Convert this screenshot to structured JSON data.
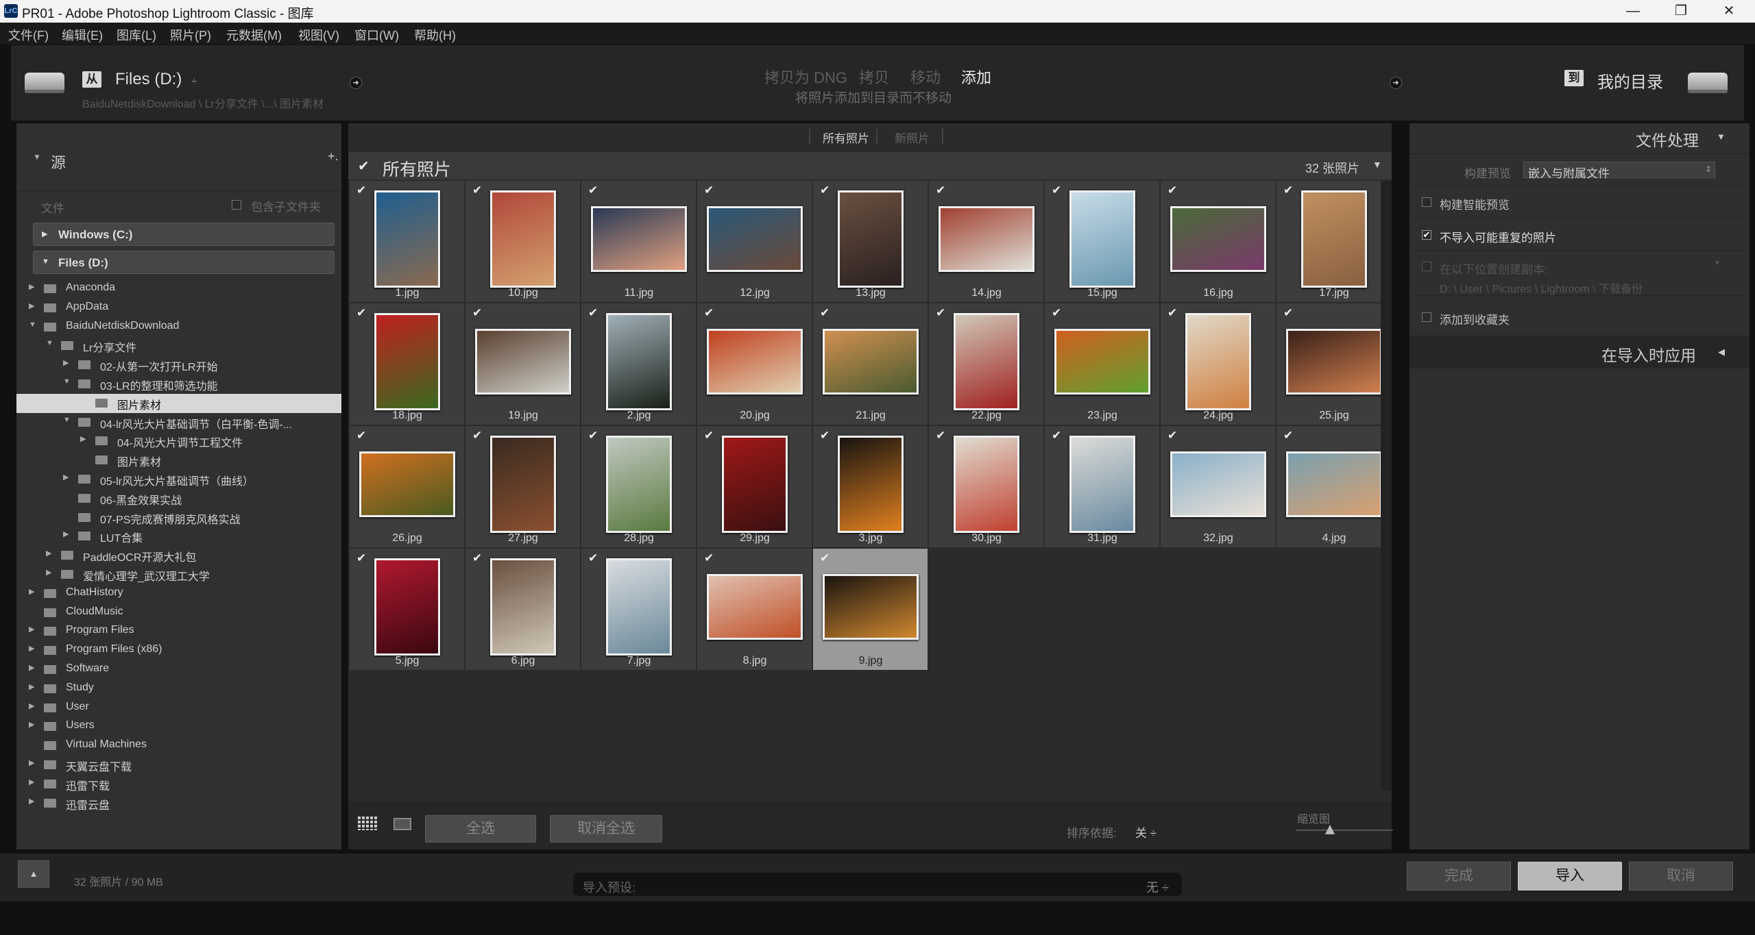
{
  "window": {
    "app_icon": "LrC",
    "title": "PR01 - Adobe Photoshop Lightroom Classic - 图库"
  },
  "menu": [
    "文件(F)",
    "编辑(E)",
    "图库(L)",
    "照片(P)",
    "元数据(M)",
    "视图(V)",
    "窗口(W)",
    "帮助(H)"
  ],
  "source_header": {
    "from_tag": "从",
    "drive": "Files (D:)",
    "path": "BaiduNetdiskDownload \\ Lr分享文件 \\...\\ 图片素材"
  },
  "mode_tabs": [
    "拷贝为 DNG",
    "拷贝",
    "移动",
    "添加"
  ],
  "active_mode": "添加",
  "mode_desc": "将照片添加到目录而不移动",
  "dest_header": {
    "to_tag": "到",
    "catalog": "我的目录"
  },
  "left_panel": {
    "title": "源",
    "add": "+.",
    "files_label": "文件",
    "include_subfolders": "包含子文件夹",
    "volumes": [
      "Windows (C:)",
      "Files (D:)"
    ],
    "tree": [
      {
        "label": "Anaconda",
        "level": 0,
        "arrow": "▶"
      },
      {
        "label": "AppData",
        "level": 0,
        "arrow": "▶"
      },
      {
        "label": "BaiduNetdiskDownload",
        "level": 0,
        "arrow": "▼"
      },
      {
        "label": "Lr分享文件",
        "level": 1,
        "arrow": "▼"
      },
      {
        "label": "02-从第一次打开LR开始",
        "level": 2,
        "arrow": "▶"
      },
      {
        "label": "03-LR的整理和筛选功能",
        "level": 2,
        "arrow": "▼"
      },
      {
        "label": "图片素材",
        "level": 3,
        "arrow": "",
        "selected": true
      },
      {
        "label": "04-lr风光大片基础调节（白平衡-色调-...",
        "level": 2,
        "arrow": "▼"
      },
      {
        "label": "04-风光大片调节工程文件",
        "level": 3,
        "arrow": "▶"
      },
      {
        "label": "图片素材",
        "level": 3,
        "arrow": ""
      },
      {
        "label": "05-lr风光大片基础调节（曲线）",
        "level": 2,
        "arrow": "▶"
      },
      {
        "label": "06-黑金效果实战",
        "level": 2,
        "arrow": ""
      },
      {
        "label": "07-PS完成赛博朋克风格实战",
        "level": 2,
        "arrow": ""
      },
      {
        "label": "LUT合集",
        "level": 2,
        "arrow": "▶"
      },
      {
        "label": "PaddleOCR开源大礼包",
        "level": 1,
        "arrow": "▶"
      },
      {
        "label": "爱情心理学_武汉理工大学",
        "level": 1,
        "arrow": "▶"
      },
      {
        "label": "ChatHistory",
        "level": 0,
        "arrow": "▶"
      },
      {
        "label": "CloudMusic",
        "level": 0,
        "arrow": ""
      },
      {
        "label": "Program Files",
        "level": 0,
        "arrow": "▶"
      },
      {
        "label": "Program Files (x86)",
        "level": 0,
        "arrow": "▶"
      },
      {
        "label": "Software",
        "level": 0,
        "arrow": "▶"
      },
      {
        "label": "Study",
        "level": 0,
        "arrow": "▶"
      },
      {
        "label": "User",
        "level": 0,
        "arrow": "▶"
      },
      {
        "label": "Users",
        "level": 0,
        "arrow": "▶"
      },
      {
        "label": "Virtual Machines",
        "level": 0,
        "arrow": ""
      },
      {
        "label": "天翼云盘下载",
        "level": 0,
        "arrow": "▶"
      },
      {
        "label": "迅雷下载",
        "level": 0,
        "arrow": "▶"
      },
      {
        "label": "迅雷云盘",
        "level": 0,
        "arrow": "▶"
      }
    ]
  },
  "grid": {
    "filter_tabs": [
      "所有照片",
      "新照片"
    ],
    "header_title": "所有照片",
    "count": "32 张照片",
    "photos": [
      {
        "name": "1.jpg",
        "orient": "p",
        "c1": "#1f5f8f",
        "c2": "#8a6a50"
      },
      {
        "name": "10.jpg",
        "orient": "p",
        "c1": "#b0483a",
        "c2": "#d4a070"
      },
      {
        "name": "11.jpg",
        "orient": "l",
        "c1": "#2a3a55",
        "c2": "#e0a080"
      },
      {
        "name": "12.jpg",
        "orient": "l",
        "c1": "#2a5878",
        "c2": "#6a4a3a"
      },
      {
        "name": "13.jpg",
        "orient": "p",
        "c1": "#6a5040",
        "c2": "#2a2020"
      },
      {
        "name": "14.jpg",
        "orient": "l",
        "c1": "#a04030",
        "c2": "#e0e0d8"
      },
      {
        "name": "15.jpg",
        "orient": "p",
        "c1": "#c8dce8",
        "c2": "#6a98b0"
      },
      {
        "name": "16.jpg",
        "orient": "l",
        "c1": "#4a6a3a",
        "c2": "#7a3a6a"
      },
      {
        "name": "17.jpg",
        "orient": "p",
        "c1": "#c09060",
        "c2": "#8a6040"
      },
      {
        "name": "18.jpg",
        "orient": "p",
        "c1": "#c02020",
        "c2": "#3a6a20"
      },
      {
        "name": "19.jpg",
        "orient": "l",
        "c1": "#5a4030",
        "c2": "#d0d0c8"
      },
      {
        "name": "2.jpg",
        "orient": "p",
        "c1": "#a0b0b8",
        "c2": "#1a2018"
      },
      {
        "name": "20.jpg",
        "orient": "l",
        "c1": "#c04020",
        "c2": "#e0d0b0"
      },
      {
        "name": "21.jpg",
        "orient": "l",
        "c1": "#d09050",
        "c2": "#4a5a30"
      },
      {
        "name": "22.jpg",
        "orient": "p",
        "c1": "#d0c8b8",
        "c2": "#a02020"
      },
      {
        "name": "23.jpg",
        "orient": "l",
        "c1": "#d06020",
        "c2": "#60a030"
      },
      {
        "name": "24.jpg",
        "orient": "p",
        "c1": "#e0d8c8",
        "c2": "#d08040"
      },
      {
        "name": "25.jpg",
        "orient": "l",
        "c1": "#3a2018",
        "c2": "#d08050"
      },
      {
        "name": "26.jpg",
        "orient": "l",
        "c1": "#d07020",
        "c2": "#4a5a20"
      },
      {
        "name": "27.jpg",
        "orient": "p",
        "c1": "#3a2a20",
        "c2": "#8a5030"
      },
      {
        "name": "28.jpg",
        "orient": "p",
        "c1": "#c0c8c0",
        "c2": "#5a7a40"
      },
      {
        "name": "29.jpg",
        "orient": "p",
        "c1": "#a01818",
        "c2": "#3a1010"
      },
      {
        "name": "3.jpg",
        "orient": "p",
        "c1": "#181410",
        "c2": "#e08020"
      },
      {
        "name": "30.jpg",
        "orient": "p",
        "c1": "#e0dcd0",
        "c2": "#c04030"
      },
      {
        "name": "31.jpg",
        "orient": "p",
        "c1": "#dcdcd8",
        "c2": "#6a8aa0"
      },
      {
        "name": "32.jpg",
        "orient": "l",
        "c1": "#8ab0c8",
        "c2": "#e8e0d8"
      },
      {
        "name": "4.jpg",
        "orient": "l",
        "c1": "#7aa0b0",
        "c2": "#d8a070"
      },
      {
        "name": "5.jpg",
        "orient": "p",
        "c1": "#b01830",
        "c2": "#3a0810"
      },
      {
        "name": "6.jpg",
        "orient": "p",
        "c1": "#6a5040",
        "c2": "#d0c8b8"
      },
      {
        "name": "7.jpg",
        "orient": "p",
        "c1": "#d8dce0",
        "c2": "#6a8898"
      },
      {
        "name": "8.jpg",
        "orient": "l",
        "c1": "#e0c0b0",
        "c2": "#c05028"
      },
      {
        "name": "9.jpg",
        "orient": "l",
        "c1": "#1a1410",
        "c2": "#d08830",
        "selected": true
      }
    ],
    "select_all": "全选",
    "deselect_all": "取消全选",
    "sort_label": "排序依据:",
    "sort_value": "关 ÷",
    "thumb_label": "缩览图",
    "thumb_level": 0.35
  },
  "right_panel": {
    "file_handling": "文件处理",
    "build_previews_label": "构建预览",
    "build_previews_value": "嵌入与附属文件",
    "smart_previews": "构建智能预览",
    "no_duplicates": "不导入可能重复的照片",
    "second_copy": "在以下位置创建副本:",
    "second_copy_path": "D: \\ User \\ Pictures \\ Lightroom \\ 下载备份",
    "add_collection": "添加到收藏夹",
    "apply_during_import": "在导入时应用"
  },
  "bottom": {
    "status": "32 张照片 / 90 MB",
    "preset_label": "导入预设:",
    "preset_value": "无 ÷",
    "done": "完成",
    "import": "导入",
    "cancel": "取消"
  },
  "colors": {
    "accent_import_bg": "#b8b8b8",
    "selected_cell": "#9a9a9a"
  }
}
